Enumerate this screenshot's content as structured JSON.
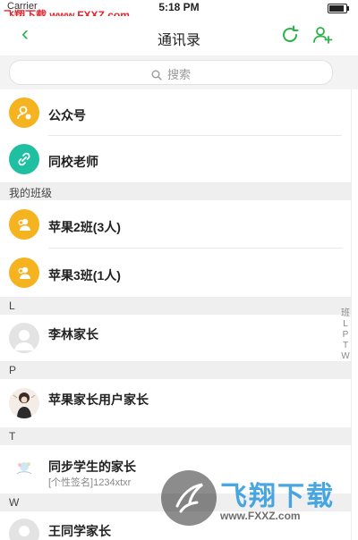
{
  "status_bar": {
    "carrier": "Carrier",
    "time": "5:18 PM"
  },
  "watermark": {
    "top_left": "飞翔下载 www.FXXZ.com",
    "bottom_big": "飞翔下载",
    "bottom_url": "www.FXXZ.com"
  },
  "nav": {
    "back_glyph": "‹",
    "title": "通讯录",
    "refresh_icon": "refresh-icon",
    "add_icon": "add-friend-icon"
  },
  "search": {
    "placeholder": "搜索"
  },
  "items": {
    "public_account": {
      "name": "公众号"
    },
    "school_teachers": {
      "name": "同校老师"
    },
    "class1": {
      "name": "苹果2班(3人)"
    },
    "class2": {
      "name": "苹果3班(1人)"
    },
    "li": {
      "name": "李林家长"
    },
    "ping": {
      "name": "苹果家长用户家长"
    },
    "tong": {
      "name": "同步学生的家长",
      "signature": "[个性签名]1234xtxr"
    },
    "wang": {
      "name": "王同学家长"
    }
  },
  "sections": {
    "my_classes": "我的班级",
    "L": "L",
    "P": "P",
    "T": "T",
    "W": "W"
  },
  "index_bar": [
    "班",
    "L",
    "P",
    "T",
    "W"
  ],
  "colors": {
    "accent": "#2bb34a",
    "orange": "#f5b320",
    "teal": "#1fbfa1"
  }
}
